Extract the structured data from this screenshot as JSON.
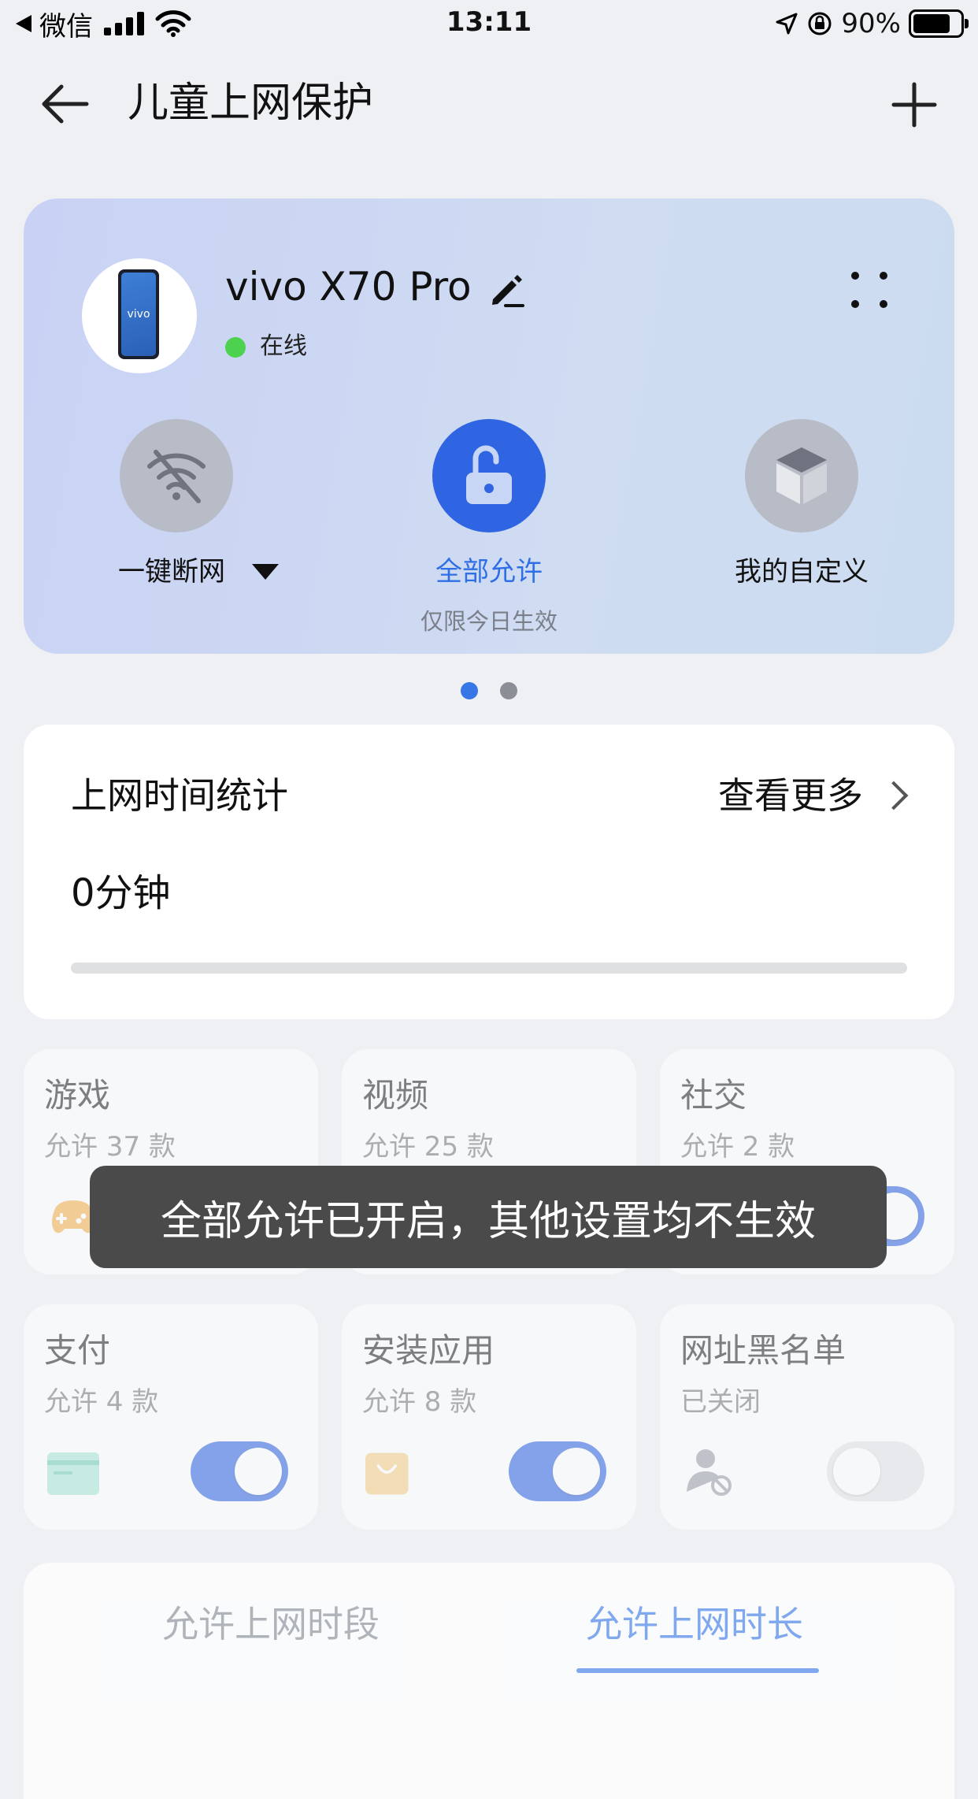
{
  "status_bar": {
    "back_app": "微信",
    "time": "13:11",
    "battery": "90%"
  },
  "header": {
    "title": "儿童上网保护"
  },
  "device": {
    "name": "vivo X70 Pro",
    "brand_on_phone": "vivo",
    "status": "在线",
    "modes": [
      {
        "label": "一键断网"
      },
      {
        "label": "全部允许",
        "note": "仅限今日生效"
      },
      {
        "label": "我的自定义"
      }
    ],
    "page_count": 2,
    "active_page": 1
  },
  "usage": {
    "title": "上网时间统计",
    "more": "查看更多",
    "value": "0分钟",
    "progress_fraction": 0
  },
  "categories": [
    {
      "title": "游戏",
      "subtitle": "允许 37 款",
      "enabled": true
    },
    {
      "title": "视频",
      "subtitle": "允许 25 款",
      "enabled": true
    },
    {
      "title": "社交",
      "subtitle": "允许 2 款",
      "enabled": true
    },
    {
      "title": "支付",
      "subtitle": "允许 4 款",
      "enabled": true
    },
    {
      "title": "安装应用",
      "subtitle": "允许 8 款",
      "enabled": true
    },
    {
      "title": "网址黑名单",
      "subtitle": "已关闭",
      "enabled": false
    }
  ],
  "toast": {
    "message": "全部允许已开启，其他设置均不生效"
  },
  "time_tabs": {
    "tabs": [
      "允许上网时段",
      "允许上网时长"
    ],
    "active": 1
  },
  "colors": {
    "accent": "#2f64e2",
    "online": "#4cd24e",
    "toast_bg": "#4a4a4a"
  }
}
